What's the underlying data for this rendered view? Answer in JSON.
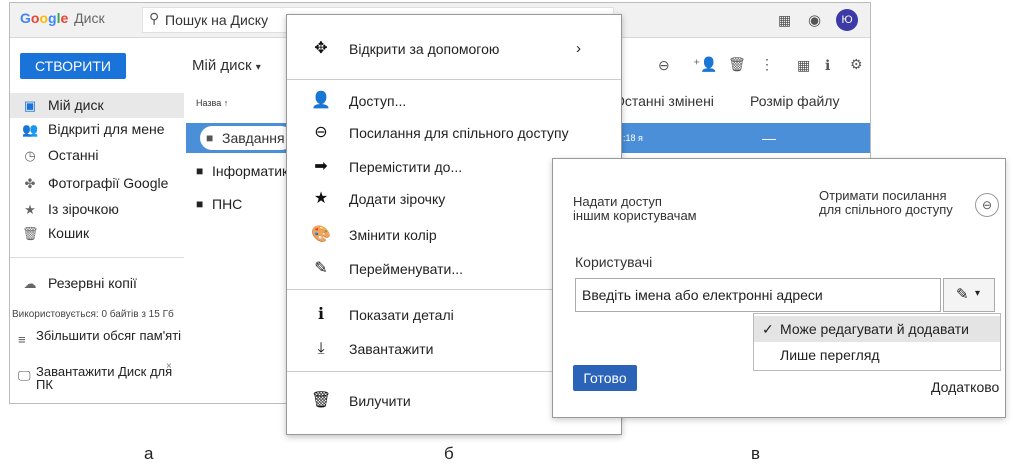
{
  "panel_labels": {
    "a": "а",
    "b": "б",
    "c": "в"
  },
  "drive": {
    "logo_google": [
      "G",
      "o",
      "o",
      "g",
      "l",
      "e"
    ],
    "logo_disk": "Диск",
    "search_placeholder": "Пошук на Диску",
    "avatar_letter": "Ю",
    "create_button": "СТВОРИТИ",
    "title": "Мій диск",
    "sidebar": [
      {
        "icon": "drive-icon",
        "glyph": "▣",
        "label": "Мій диск"
      },
      {
        "icon": "shared-icon",
        "glyph": "👥",
        "label": "Відкриті для мене"
      },
      {
        "icon": "clock-icon",
        "glyph": "◷",
        "label": "Останні"
      },
      {
        "icon": "photos-icon",
        "glyph": "✤",
        "label": "Фотографії Google"
      },
      {
        "icon": "star-icon",
        "glyph": "★",
        "label": "Із зірочкою"
      },
      {
        "icon": "trash-icon",
        "glyph": "🗑",
        "label": "Кошик"
      },
      {
        "icon": "cloud-icon",
        "glyph": "☁",
        "label": "Резервні копії"
      }
    ],
    "storage_text": "Використовується: 0 байтів з 15 Гб",
    "upgrade_storage": "Збільшити обсяг пам'яті",
    "download_drive": "Завантажити Диск для ПК",
    "columns": {
      "name": "Назва ↑",
      "modified": "Останні змінені",
      "size": "Розмір файлу"
    },
    "files": [
      {
        "name": "Завдання",
        "modified": "…:18 я",
        "size": "—",
        "selected": true
      },
      {
        "name": "Інформатик",
        "modified": "",
        "size": "",
        "selected": false
      },
      {
        "name": "ПНС",
        "modified": "",
        "size": "",
        "selected": false
      }
    ]
  },
  "context_menu": {
    "items": [
      {
        "icon": "open-with-icon",
        "glyph": "✥",
        "label": "Відкрити за допомогою",
        "arrow": "›"
      },
      {
        "icon": "add-person-icon",
        "glyph": "👤",
        "label": "Доступ..."
      },
      {
        "icon": "link-icon",
        "glyph": "⊖",
        "label": "Посилання для спільного доступу"
      },
      {
        "icon": "move-icon",
        "glyph": "➡",
        "label": "Перемістити до..."
      },
      {
        "icon": "star-icon",
        "glyph": "★",
        "label": "Додати зірочку"
      },
      {
        "icon": "palette-icon",
        "glyph": "🎨",
        "label": "Змінити колір"
      },
      {
        "icon": "rename-icon",
        "glyph": "✎",
        "label": "Перейменувати..."
      },
      {
        "icon": "info-icon",
        "glyph": "ℹ",
        "label": "Показати деталі"
      },
      {
        "icon": "download-icon",
        "glyph": "⤓",
        "label": "Завантажити"
      },
      {
        "icon": "delete-icon",
        "glyph": "🗑",
        "label": "Вилучити"
      }
    ]
  },
  "share_dialog": {
    "share_title_line1": "Надати доступ",
    "share_title_line2": "іншим користувачам",
    "link_title_line1": "Отримати посилання",
    "link_title_line2": "для спільного доступу",
    "users_label": "Користувачі",
    "users_input_placeholder": "Введіть імена або електронні адреси",
    "permission_options": [
      {
        "label": "Може редагувати й додавати",
        "checked": true
      },
      {
        "label": "Лише перегляд",
        "checked": false
      }
    ],
    "check_mark": "✓",
    "done_button": "Готово",
    "more_link": "Додатково"
  },
  "colors": {
    "accent": "#1a73d9",
    "selected_row": "#4b8fd8",
    "done_button": "#2a63b8",
    "avatar": "#3c3aa6"
  }
}
